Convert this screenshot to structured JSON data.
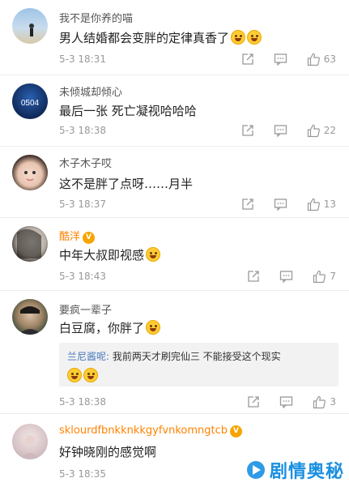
{
  "comments": [
    {
      "name": "我不是你养的喵",
      "text": "男人结婚都会变胖的定律真香了",
      "emoji_count": 2,
      "time": "5-3 18:31",
      "likes": "63"
    },
    {
      "name": "未倾城却倾心",
      "text": "最后一张 死亡凝视哈哈哈",
      "time": "5-3 18:38",
      "likes": "22"
    },
    {
      "name": "木子木子哎",
      "text": "这不是胖了点呀……月半",
      "time": "5-3 18:37",
      "likes": "13"
    },
    {
      "name": "酷洋",
      "text": "中年大叔即视感",
      "time": "5-3 18:43",
      "likes": "7"
    },
    {
      "name": "要疯一辈子",
      "text": "白豆腐，你胖了",
      "time": "5-3 18:38",
      "likes": "3",
      "reply": {
        "author": "兰尼酱呢:",
        "text": " 我前两天才刷完仙三 不能接受这个现实"
      }
    },
    {
      "name": "sklourdfbnkknkkgyfvnkomngtcb",
      "text": "好钟晓刚的感觉啊",
      "time": "5-3 18:35"
    }
  ],
  "watermark": "剧情奥秘",
  "colors": {
    "accent": "#ff8200",
    "link": "#4477bb",
    "muted": "#999999"
  }
}
